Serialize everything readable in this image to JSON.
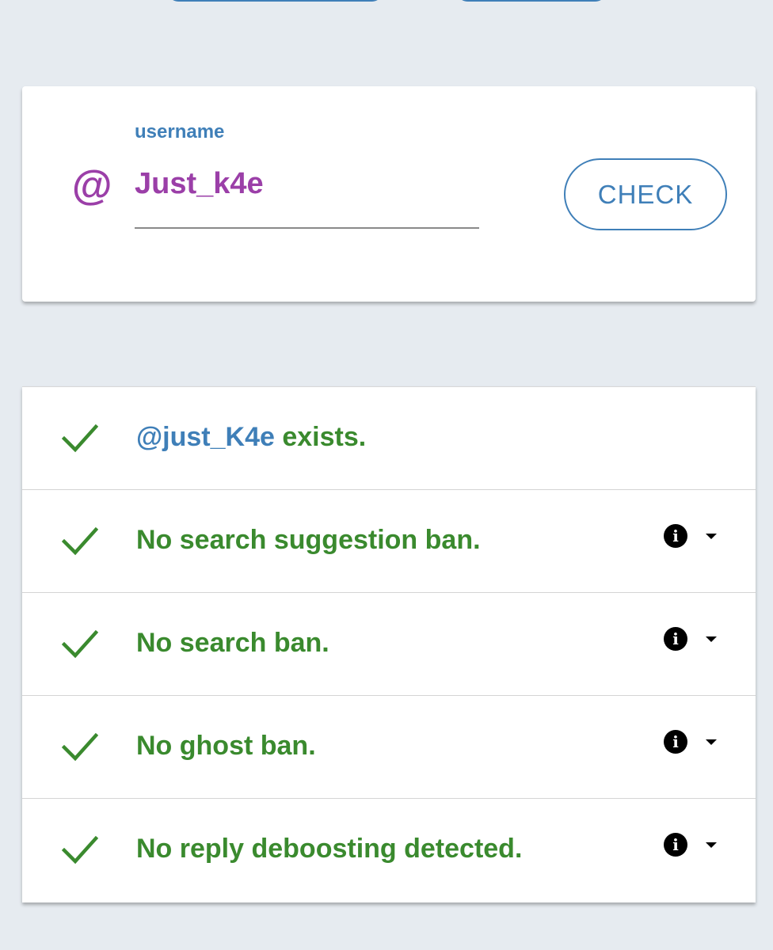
{
  "search": {
    "label": "username",
    "value": "Just_k4e",
    "at_symbol": "@",
    "button_label": "CHECK"
  },
  "results": [
    {
      "handle": "@just_K4e",
      "text": " exists.",
      "has_info": false
    },
    {
      "handle": "",
      "text": "No search suggestion ban.",
      "has_info": true
    },
    {
      "handle": "",
      "text": "No search ban.",
      "has_info": true
    },
    {
      "handle": "",
      "text": "No ghost ban.",
      "has_info": true
    },
    {
      "handle": "",
      "text": "No reply deboosting detected.",
      "has_info": true
    }
  ],
  "icons": {
    "status": "check-icon",
    "info": "info-icon",
    "expand": "caret-down-icon"
  },
  "colors": {
    "accent_blue": "#3f7fb8",
    "username_purple": "#9b3fa8",
    "success_green": "#3a8a2e",
    "background": "#e6ebf0"
  }
}
